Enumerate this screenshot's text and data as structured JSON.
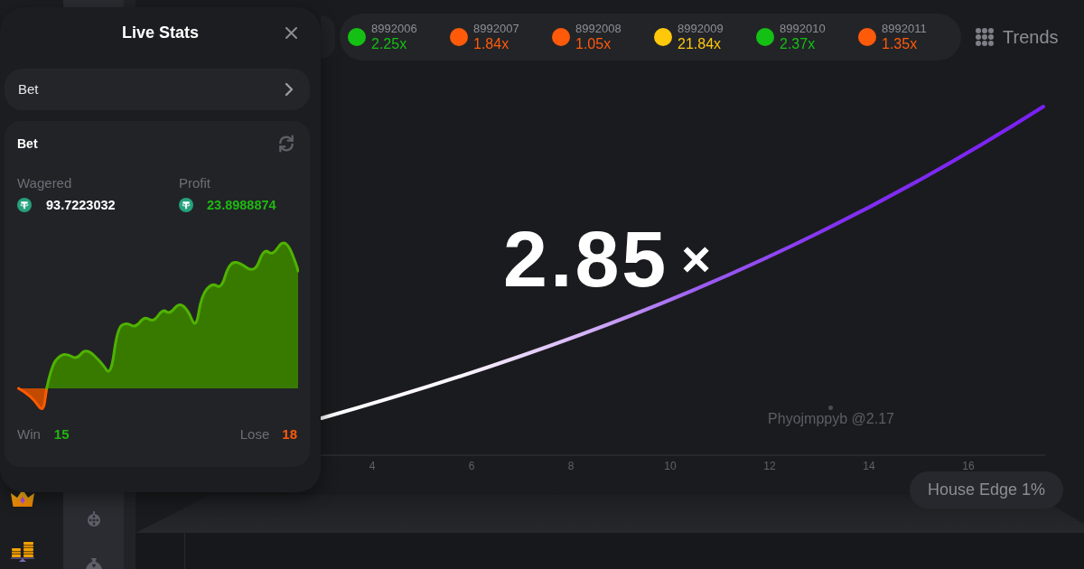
{
  "live_stats": {
    "title": "Live Stats",
    "filter": {
      "label": "Bet"
    },
    "card": {
      "title": "Bet",
      "wagered": {
        "label": "Wagered",
        "value": "93.7223032"
      },
      "profit": {
        "label": "Profit",
        "value": "23.8988874"
      },
      "win": {
        "label": "Win",
        "value": "15"
      },
      "lose": {
        "label": "Lose",
        "value": "18"
      }
    }
  },
  "history": [
    {
      "round": "8992006",
      "multiplier": "2.25x",
      "color": "#14c014"
    },
    {
      "round": "8992007",
      "multiplier": "1.84x",
      "color": "#ff5a0a"
    },
    {
      "round": "8992008",
      "multiplier": "1.05x",
      "color": "#ff5a0a"
    },
    {
      "round": "8992009",
      "multiplier": "21.84x",
      "color": "#ffc80a"
    },
    {
      "round": "8992010",
      "multiplier": "2.37x",
      "color": "#14c014"
    },
    {
      "round": "8992011",
      "multiplier": "1.35x",
      "color": "#ff5a0a"
    }
  ],
  "trends": {
    "label": "Trends"
  },
  "game": {
    "multiplier": "2.85",
    "multiplier_sign": "×",
    "x_axis": [
      "4",
      "6",
      "8",
      "10",
      "12",
      "14",
      "16"
    ],
    "player": "Phyojmppyb @2.17"
  },
  "house_edge": "House Edge 1%"
}
